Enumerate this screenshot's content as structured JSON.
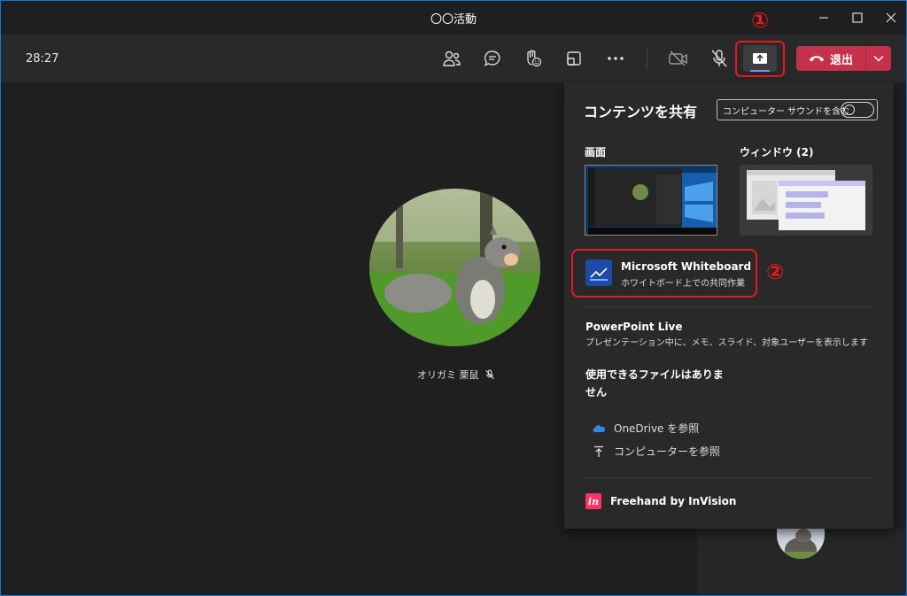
{
  "window": {
    "title": "〇〇活動"
  },
  "toolbar": {
    "timer": "28:27",
    "leave_label": "退出"
  },
  "annotations": {
    "step1": "①",
    "step2": "②"
  },
  "participant": {
    "name": "オリガミ 栗鼠"
  },
  "share_panel": {
    "title": "コンテンツを共有",
    "include_sound_label": "コンピューター サウンドを含む",
    "screen_label": "画面",
    "window_label": "ウィンドウ (2)",
    "whiteboard_title": "Microsoft Whiteboard",
    "whiteboard_sub": "ホワイトボード上での共同作業",
    "powerpoint_title": "PowerPoint Live",
    "powerpoint_sub": "プレゼンテーション中に、メモ、スライド、対象ユーザーを表示します",
    "no_files": "使用できるファイルはありません",
    "onedrive_label": "OneDrive を参照",
    "computer_label": "コンピューターを参照",
    "freehand_label": "Freehand by InVision",
    "freehand_icon_text": "in"
  },
  "colors": {
    "accent": "#8b8cf1",
    "leave": "#c4314b",
    "highlight": "#e8181f"
  }
}
